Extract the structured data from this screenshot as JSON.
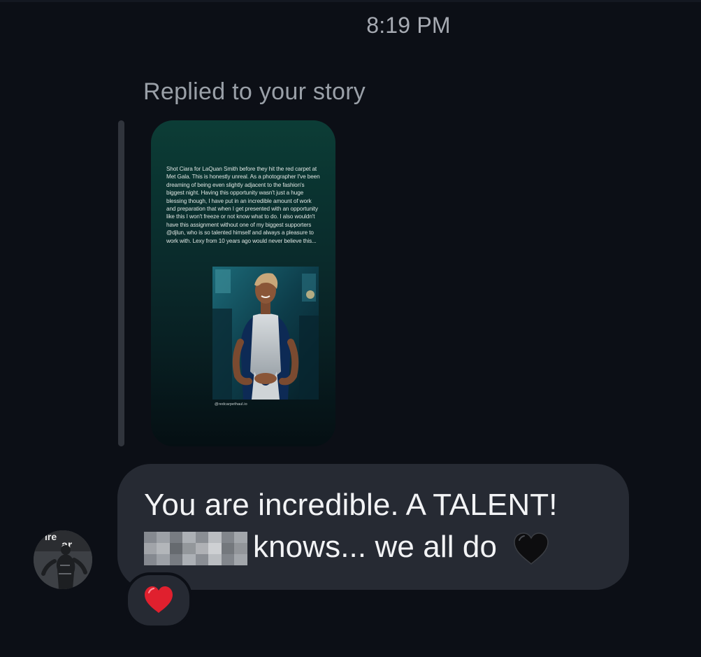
{
  "thread": {
    "timestamp": "8:19 PM",
    "reply_label": "Replied to your story"
  },
  "story": {
    "caption": "Shot Ciara for LaQuan Smith before they hit the red carpet at Met Gala. This is honestly unreal. As a photographer I've been dreaming of being even slightly adjacent to the fashion's biggest night. Having this opportunity wasn't just a huge blessing though, I have put in an incredible amount of work and preparation that when I get presented with an opportunity like this I won't freeze or not know what to do. I also wouldn't have this assignment without one of my biggest supporters @djlun, who is so talented himself and always a pleasure to work with. Lexy from 10 years ago would never believe this...",
    "photo_credit": "@redcarpethaul.io",
    "photo_subject": "woman in embellished halter gown"
  },
  "message": {
    "line1": "You are incredible. A TALENT!",
    "line2": "knows... we all do",
    "redacted": true,
    "emoji": "black-heart"
  },
  "sender": {
    "avatar_text": "ar",
    "avatar_icon": "avatar-photo"
  },
  "reaction": {
    "emoji": "red-heart"
  },
  "colors": {
    "background": "#0c0f16",
    "bubble": "#262a33",
    "text": "#f2f3f5",
    "muted": "#9aa0a8",
    "reaction_red": "#e0202e"
  }
}
